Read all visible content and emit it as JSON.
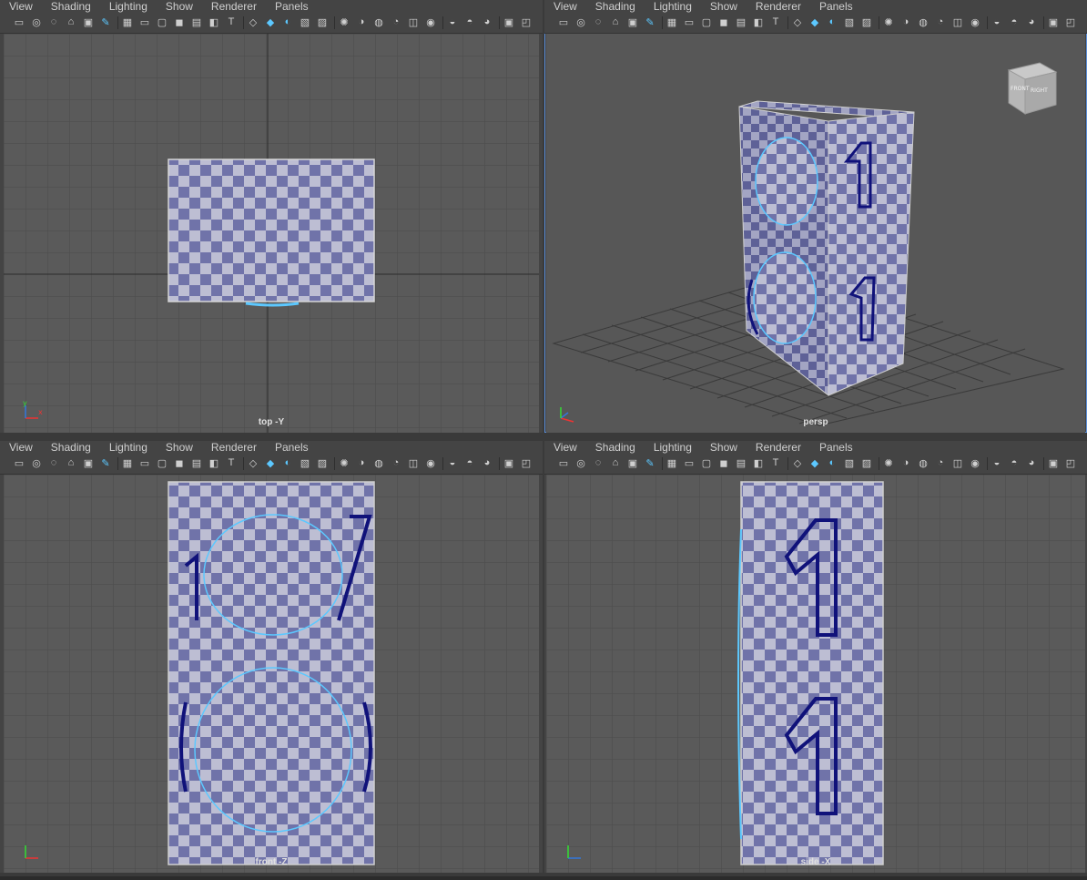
{
  "menus": [
    "View",
    "Shading",
    "Lighting",
    "Show",
    "Renderer",
    "Panels"
  ],
  "panels": [
    {
      "id": "top",
      "label": "top -Y"
    },
    {
      "id": "persp",
      "label": "persp"
    },
    {
      "id": "front",
      "label": "front -Z"
    },
    {
      "id": "side",
      "label": "side -X"
    }
  ],
  "viewcube": {
    "front": "FRONT",
    "right": "RIGHT"
  },
  "axis": {
    "x": "x",
    "y": "y",
    "z": "z"
  },
  "icons": [
    "camera-icon",
    "camera-attr-icon",
    "bookmark-icon",
    "image-plane-icon",
    "2d-pan-icon",
    "grease-pencil-icon",
    "grid-icon",
    "film-gate-icon",
    "resolution-gate-icon",
    "gate-mask-icon",
    "field-chart-icon",
    "safe-action-icon",
    "safe-title-icon",
    "wireframe-icon",
    "smooth-shade-icon",
    "default-material-icon",
    "wireframe-on-shaded-icon",
    "textured-icon",
    "use-all-lights-icon",
    "shadows-icon",
    "screen-space-ao-icon",
    "motion-blur-icon",
    "multisample-aa-icon",
    "depth-of-field-icon",
    "isolate-select-icon",
    "xray-icon",
    "xray-joints-icon",
    "panel-layout-icon",
    "stereo-icon"
  ],
  "colors": {
    "viewport": "#5a5a5a",
    "checker_dark": "#7073a9",
    "checker_light": "#bdbed3",
    "wire": "#5cc8ff",
    "outline": "#10127a"
  }
}
